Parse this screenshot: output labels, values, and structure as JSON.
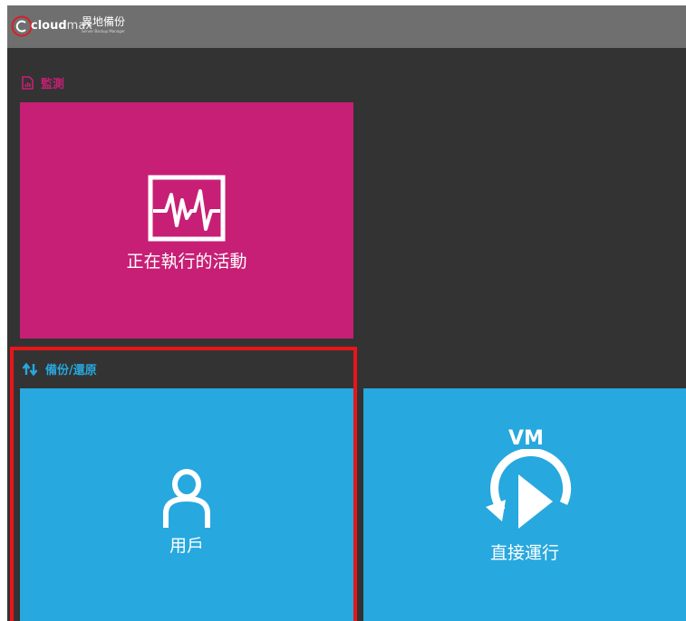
{
  "header": {
    "brand_bold": "cloud",
    "brand_light": "max",
    "brand_cn": "異地備份",
    "brand_sub": "Server Backup Manager"
  },
  "sections": {
    "monitor": {
      "icon": "document-chart-icon",
      "label": "監測"
    },
    "backup": {
      "icon": "up-down-arrows-icon",
      "label": "備份/還原"
    }
  },
  "tiles": {
    "activity": {
      "icon": "heartbeat-monitor-icon",
      "label": "正在執行的活動",
      "color": "#c71f75"
    },
    "users": {
      "icon": "user-icon",
      "label": "用戶",
      "color": "#27a8de"
    },
    "vm": {
      "icon": "vm-play-icon",
      "badge": "VM",
      "label": "直接運行",
      "color": "#27a8de"
    }
  },
  "colors": {
    "topbar": "#6f6f6f",
    "background": "#333333",
    "monitor_accent": "#c71f75",
    "backup_accent": "#27a8de",
    "highlight_border": "#e8151b"
  }
}
